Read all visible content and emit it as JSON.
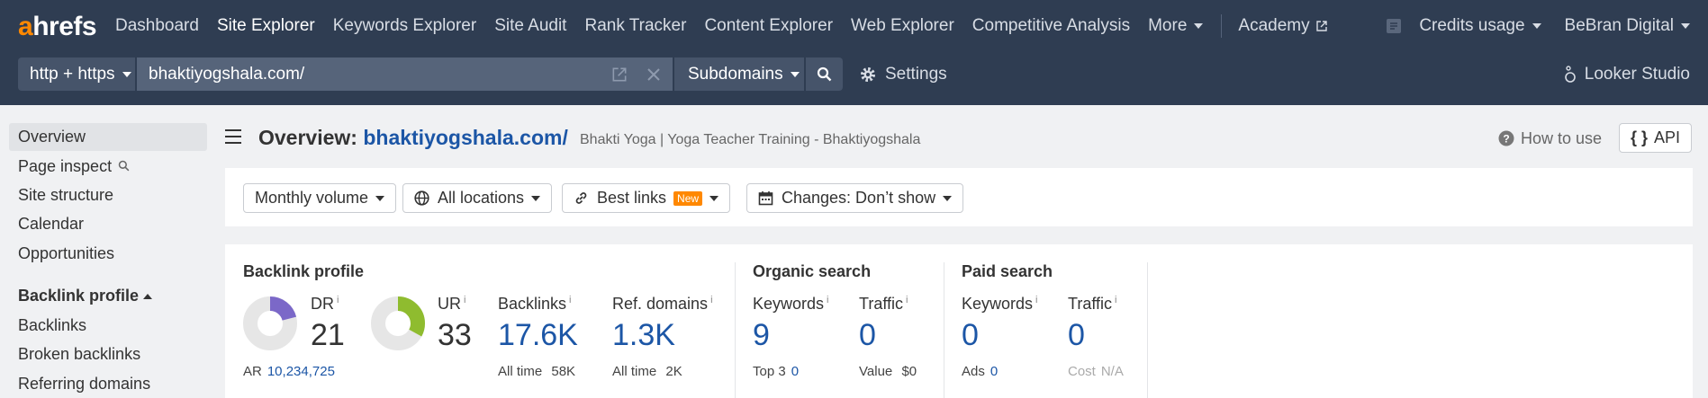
{
  "brand": {
    "logo_a": "a",
    "logo_rest": "hrefs",
    "accent": "#ff8800",
    "nav_bg": "#2f3d52",
    "link_color": "#1c56a6"
  },
  "nav": {
    "items": [
      "Dashboard",
      "Site Explorer",
      "Keywords Explorer",
      "Site Audit",
      "Rank Tracker",
      "Content Explorer",
      "Web Explorer",
      "Competitive Analysis"
    ],
    "active": "Site Explorer",
    "more": "More",
    "academy": "Academy",
    "credits": "Credits usage",
    "account": "BeBran Digital"
  },
  "search": {
    "protocol": "http + https",
    "url": "bhaktiyogshala.com/",
    "mode": "Subdomains",
    "settings": "Settings",
    "looker": "Looker Studio"
  },
  "sidebar": {
    "items": [
      "Overview",
      "Page inspect",
      "Site structure",
      "Calendar",
      "Opportunities"
    ],
    "section": "Backlink profile",
    "section_items": [
      "Backlinks",
      "Broken backlinks",
      "Referring domains"
    ]
  },
  "header": {
    "title_prefix": "Overview:",
    "title_link": "bhaktiyogshala.com/",
    "subtitle": "Bhakti Yoga | Yoga Teacher Training - Bhaktiyogshala",
    "how_to": "How to use",
    "api": "API"
  },
  "filters": {
    "volume": "Monthly volume",
    "locations": "All locations",
    "best_links": "Best links",
    "new_badge": "New",
    "changes": "Changes: Don’t show"
  },
  "metrics": {
    "backlink_profile": {
      "title": "Backlink profile",
      "dr_label": "DR",
      "dr_value": "21",
      "dr_fill": 0.21,
      "ur_label": "UR",
      "ur_value": "33",
      "ur_fill": 0.33,
      "ar_label": "AR",
      "ar_value": "10,234,725",
      "backlinks_label": "Backlinks",
      "backlinks_value": "17.6K",
      "backlinks_all_label": "All time",
      "backlinks_all": "58K",
      "refdomains_label": "Ref. domains",
      "refdomains_value": "1.3K",
      "refdomains_all_label": "All time",
      "refdomains_all": "2K"
    },
    "organic": {
      "title": "Organic search",
      "keywords_label": "Keywords",
      "keywords_value": "9",
      "top3_label": "Top 3",
      "top3_value": "0",
      "traffic_label": "Traffic",
      "traffic_value": "0",
      "value_label": "Value",
      "value_value": "$0"
    },
    "paid": {
      "title": "Paid search",
      "keywords_label": "Keywords",
      "keywords_value": "0",
      "ads_label": "Ads",
      "ads_value": "0",
      "traffic_label": "Traffic",
      "traffic_value": "0",
      "cost_label": "Cost",
      "cost_value": "N/A"
    },
    "dr_color": "#7b68c8",
    "ur_color": "#8fbc2f"
  }
}
